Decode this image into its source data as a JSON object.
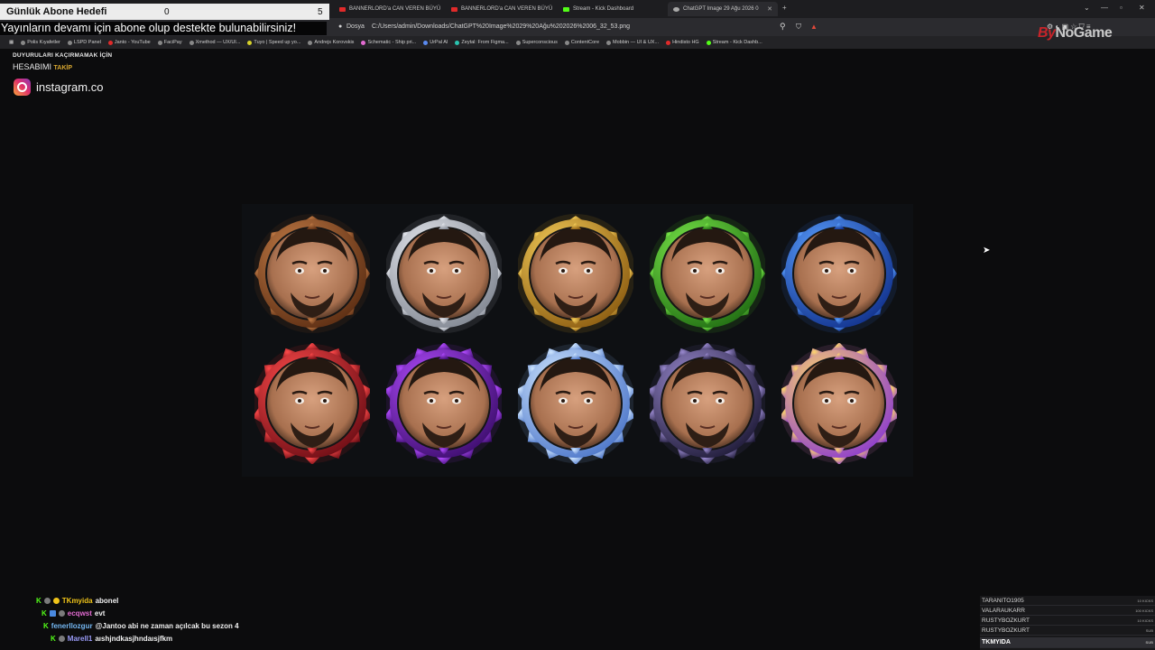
{
  "goal": {
    "label": "Günlük Abone Hedefi",
    "current": "0",
    "target": "5"
  },
  "ticker": "Yayınların devamı için abone olup destekte bulunabilirsiniz!",
  "brand": {
    "prefix": "By",
    "name": "NoGame"
  },
  "promo": {
    "line1": "DUYURULARI KAÇIRMAMAK İÇİN",
    "line2": "HESABIMI",
    "line2_accent": "TAKİP",
    "instagram": "instagram.co"
  },
  "tabs": [
    {
      "label": "BANNERLORD'a CAN VEREN BÜYÜ",
      "color": "#e02a2a"
    },
    {
      "label": "BANNERLORD'a CAN VEREN BÜYÜ",
      "color": "#e02a2a"
    },
    {
      "label": "Stream - Kick Dashboard",
      "color": "#53fc18"
    },
    {
      "label": "ChatGPT Image 29 Ağu 2026 0",
      "color": "#aaaaaa"
    }
  ],
  "address": {
    "scheme": "Dosya",
    "url": "C:/Users/admin/Downloads/ChatGPT%20Image%2029%20Ağu%202026%2006_32_53.png"
  },
  "bookmarks": [
    "Polis Kıyafetler",
    "LSPD Panel",
    "Janto - YouTube",
    "FaciPay",
    "Xmethod — UX/UI...",
    "Tuyo | Speed up yo...",
    "Andrejs Korovskis",
    "Schematic - Ship pri...",
    "UrPal AI",
    "Zeytal: From Figma...",
    "Superconscious",
    "ContentCore",
    "Mobbin — UI & UX...",
    "Hindisto HG",
    "Stream - Kick Dashb..."
  ],
  "badges": [
    {
      "name": "bronze",
      "c1": "#c07a45",
      "c2": "#5a2c12",
      "glow": "#8a4a20"
    },
    {
      "name": "silver",
      "c1": "#e6e8ee",
      "c2": "#7f8590",
      "glow": "#aab0ba"
    },
    {
      "name": "gold",
      "c1": "#f6cf5a",
      "c2": "#8a5a10",
      "glow": "#d69c25"
    },
    {
      "name": "emerald",
      "c1": "#7bea4a",
      "c2": "#1f6a12",
      "glow": "#46c023"
    },
    {
      "name": "sapphire",
      "c1": "#5aa0ff",
      "c2": "#102f8a",
      "glow": "#2f6ae0"
    },
    {
      "name": "ruby",
      "c1": "#ff4a4a",
      "c2": "#6a0c14",
      "glow": "#d21f2a"
    },
    {
      "name": "amethyst",
      "c1": "#b24bff",
      "c2": "#3a0c6a",
      "glow": "#8a26d8"
    },
    {
      "name": "diamond",
      "c1": "#cfe6ff",
      "c2": "#4a74c8",
      "glow": "#8ab6f5"
    },
    {
      "name": "master",
      "c1": "#9a8ad0",
      "c2": "#1c1834",
      "glow": "#6a5ab0"
    },
    {
      "name": "prismatic",
      "c1": "#ffd86a",
      "c2": "#8a38d0",
      "glow": "#e87ad0"
    }
  ],
  "chat": [
    {
      "user": "TKmyida",
      "msg": "abonel",
      "color": "#f0c419"
    },
    {
      "user": "ecqwst",
      "msg": "evt",
      "color": "#e26bd1"
    },
    {
      "user": "fenerllozgur",
      "msg": "@Jantoo abi ne zaman açılcak bu sezon 4",
      "color": "#74b7f2"
    },
    {
      "user": "Marell1",
      "msg": "aıshjndkasjhndaısjfkm",
      "color": "#9a9bf7"
    }
  ],
  "leaderboard": [
    {
      "name": "TARANITO1905",
      "amount": "10 KICKS"
    },
    {
      "name": "VALARAUKARR",
      "amount": "100 KICKS"
    },
    {
      "name": "RUSTYBOZKURT",
      "amount": "10 KICKS"
    },
    {
      "name": "RUSTYBOZKURT",
      "amount": "SUB"
    },
    {
      "name": "TKMYIDA",
      "amount": "SUB"
    }
  ]
}
